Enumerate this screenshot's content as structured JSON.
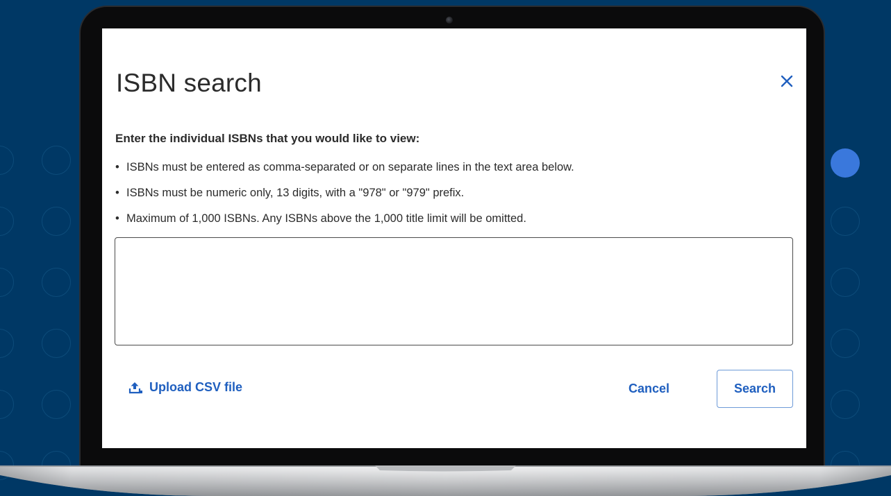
{
  "dialog": {
    "title": "ISBN search",
    "close_icon": "close-icon",
    "instructions_heading": "Enter the individual ISBNs that you would like to view:",
    "rules": [
      "ISBNs must be entered as comma-separated or on separate lines in the text area below.",
      "ISBNs must be numeric only, 13 digits, with a \"978\" or \"979\" prefix.",
      "Maximum of 1,000 ISBNs. Any ISBNs above the 1,000 title limit will be omitted."
    ],
    "textarea": {
      "value": "",
      "placeholder": ""
    },
    "upload": {
      "label": "Upload CSV file",
      "icon": "upload-icon"
    },
    "cancel_label": "Cancel",
    "search_label": "Search"
  },
  "colors": {
    "background": "#003865",
    "accent": "#1f5fbf",
    "accent_circle": "#3a78dc",
    "text": "#2b2b2b"
  }
}
